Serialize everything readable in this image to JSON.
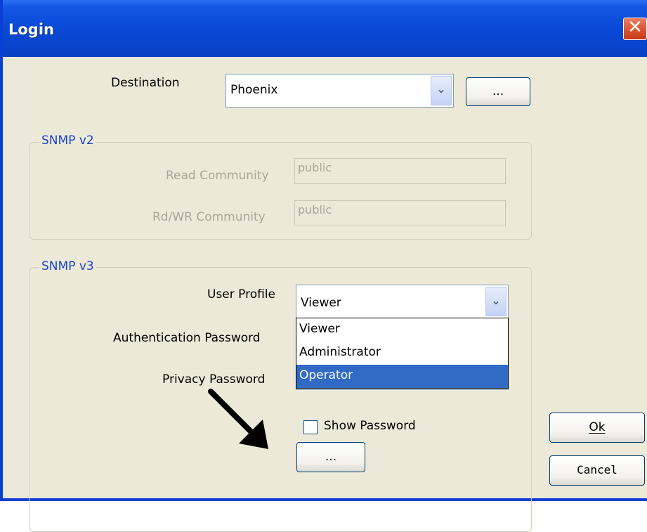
{
  "window": {
    "title": "Login"
  },
  "destination": {
    "label": "Destination",
    "value": "Phoenix",
    "browse_label": "..."
  },
  "snmp_v2": {
    "group_label": "SNMP v2",
    "read_community_label": "Read Community",
    "read_community_value": "public",
    "rdwr_community_label": "Rd/WR Community",
    "rdwr_community_value": "public"
  },
  "snmp_v3": {
    "group_label": "SNMP v3",
    "user_profile_label": "User Profile",
    "user_profile_value": "Viewer",
    "user_profile_options": [
      "Viewer",
      "Administrator",
      "Operator"
    ],
    "highlighted_option": "Operator",
    "auth_password_label": "Authentication Password",
    "privacy_password_label": "Privacy Password",
    "show_password_label": "Show Password",
    "show_password_checked": false,
    "browse_label": "..."
  },
  "buttons": {
    "ok": "Ok",
    "cancel": "Cancel"
  },
  "icons": {
    "close": "close-icon",
    "dropdown": "chevron-down-icon",
    "annotation": "arrow-annotation-icon"
  },
  "colors": {
    "titlebar": "#0a4bd8",
    "dialog_bg": "#ece9d8",
    "selection": "#316ac5",
    "group_label": "#1a44c8"
  }
}
